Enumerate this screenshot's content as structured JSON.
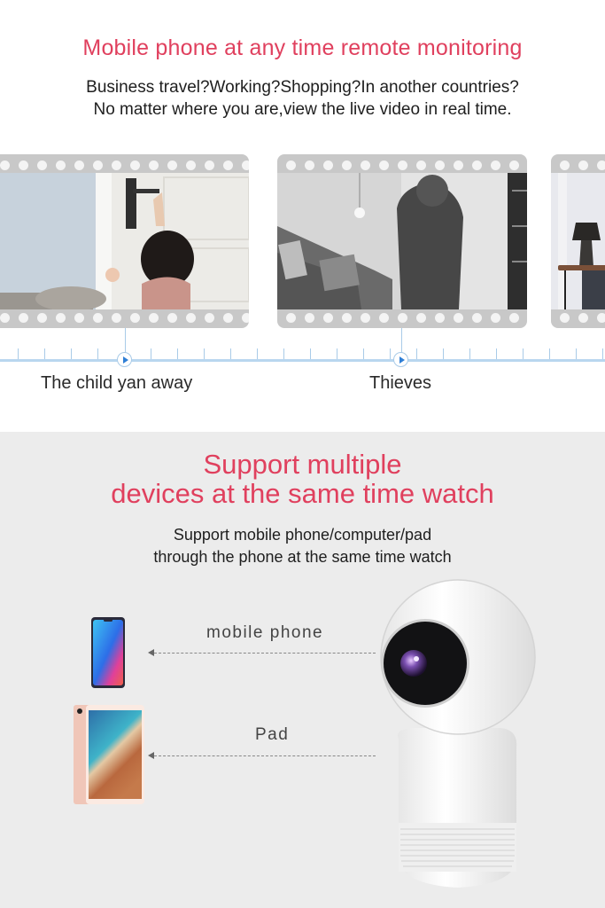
{
  "monitoring": {
    "title": "Mobile phone at any time remote monitoring",
    "subtitle_line1": "Business travel?Working?Shopping?In another countries?",
    "subtitle_line2": "No matter where you are,view the live video in real time.",
    "clips": [
      {
        "caption": "The child yan away",
        "scene": "child-at-door"
      },
      {
        "caption": "Thieves",
        "scene": "intruder"
      },
      {
        "caption": "",
        "scene": "lamp-room"
      }
    ],
    "accent_color": "#e0405e",
    "timeline_color": "#b9d6ef",
    "play_color": "#2f7fd6"
  },
  "devices": {
    "title_line1": "Support multiple",
    "title_line2": "devices at the same time watch",
    "subtitle_line1": "Support mobile phone/computer/pad",
    "subtitle_line2": "through the phone at the same time watch",
    "items": [
      {
        "label": "mobile phone",
        "icon": "smartphone-icon"
      },
      {
        "label": "Pad",
        "icon": "tablet-icon"
      }
    ],
    "camera": "ip-camera-image",
    "background_color": "#ececec"
  }
}
